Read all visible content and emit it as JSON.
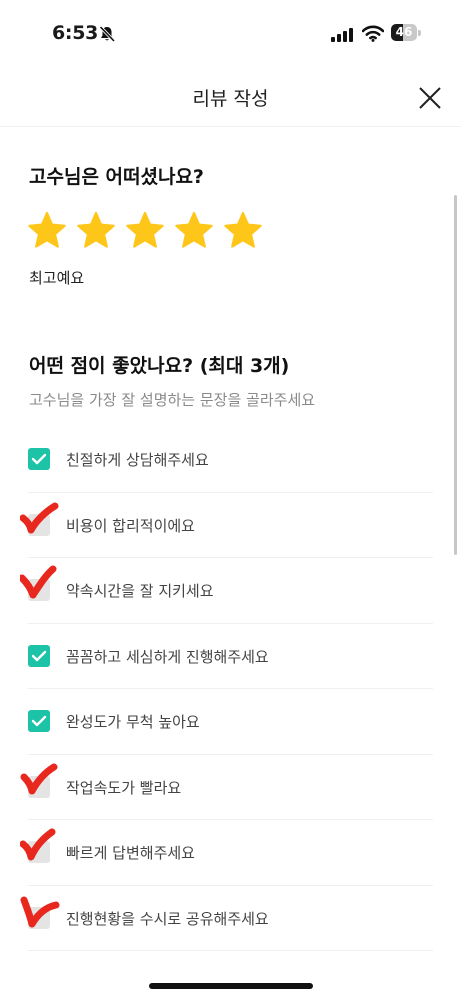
{
  "status_bar": {
    "time": "6:53",
    "battery": "46",
    "battery_level": 0.46,
    "mute_icon": "bell-slash-icon"
  },
  "header": {
    "title": "리뷰 작성",
    "close_icon": "close-icon"
  },
  "rating": {
    "question": "고수님은 어떠셨나요?",
    "stars": 5,
    "max_stars": 5,
    "caption": "최고예요",
    "star_color": "#FFC61A"
  },
  "strengths": {
    "heading": "어떤 점이 좋았나요? (최대 3개)",
    "subheading": "고수님을 가장 잘 설명하는 문장을 골라주세요",
    "check_color": "#1DC3A7",
    "annotation_color": "#E8271E",
    "options": [
      {
        "label": "친절하게 상담해주세요",
        "checked": true,
        "hand_mark": false
      },
      {
        "label": "비용이 합리적이에요",
        "checked": false,
        "hand_mark": true
      },
      {
        "label": "약속시간을 잘 지키세요",
        "checked": false,
        "hand_mark": true
      },
      {
        "label": "꼼꼼하고 세심하게 진행해주세요",
        "checked": true,
        "hand_mark": false
      },
      {
        "label": "완성도가 무척 높아요",
        "checked": true,
        "hand_mark": false
      },
      {
        "label": "작업속도가 빨라요",
        "checked": false,
        "hand_mark": true
      },
      {
        "label": "빠르게 답변해주세요",
        "checked": false,
        "hand_mark": true
      },
      {
        "label": "진행현황을 수시로 공유해주세요",
        "checked": false,
        "hand_mark": true
      }
    ]
  }
}
